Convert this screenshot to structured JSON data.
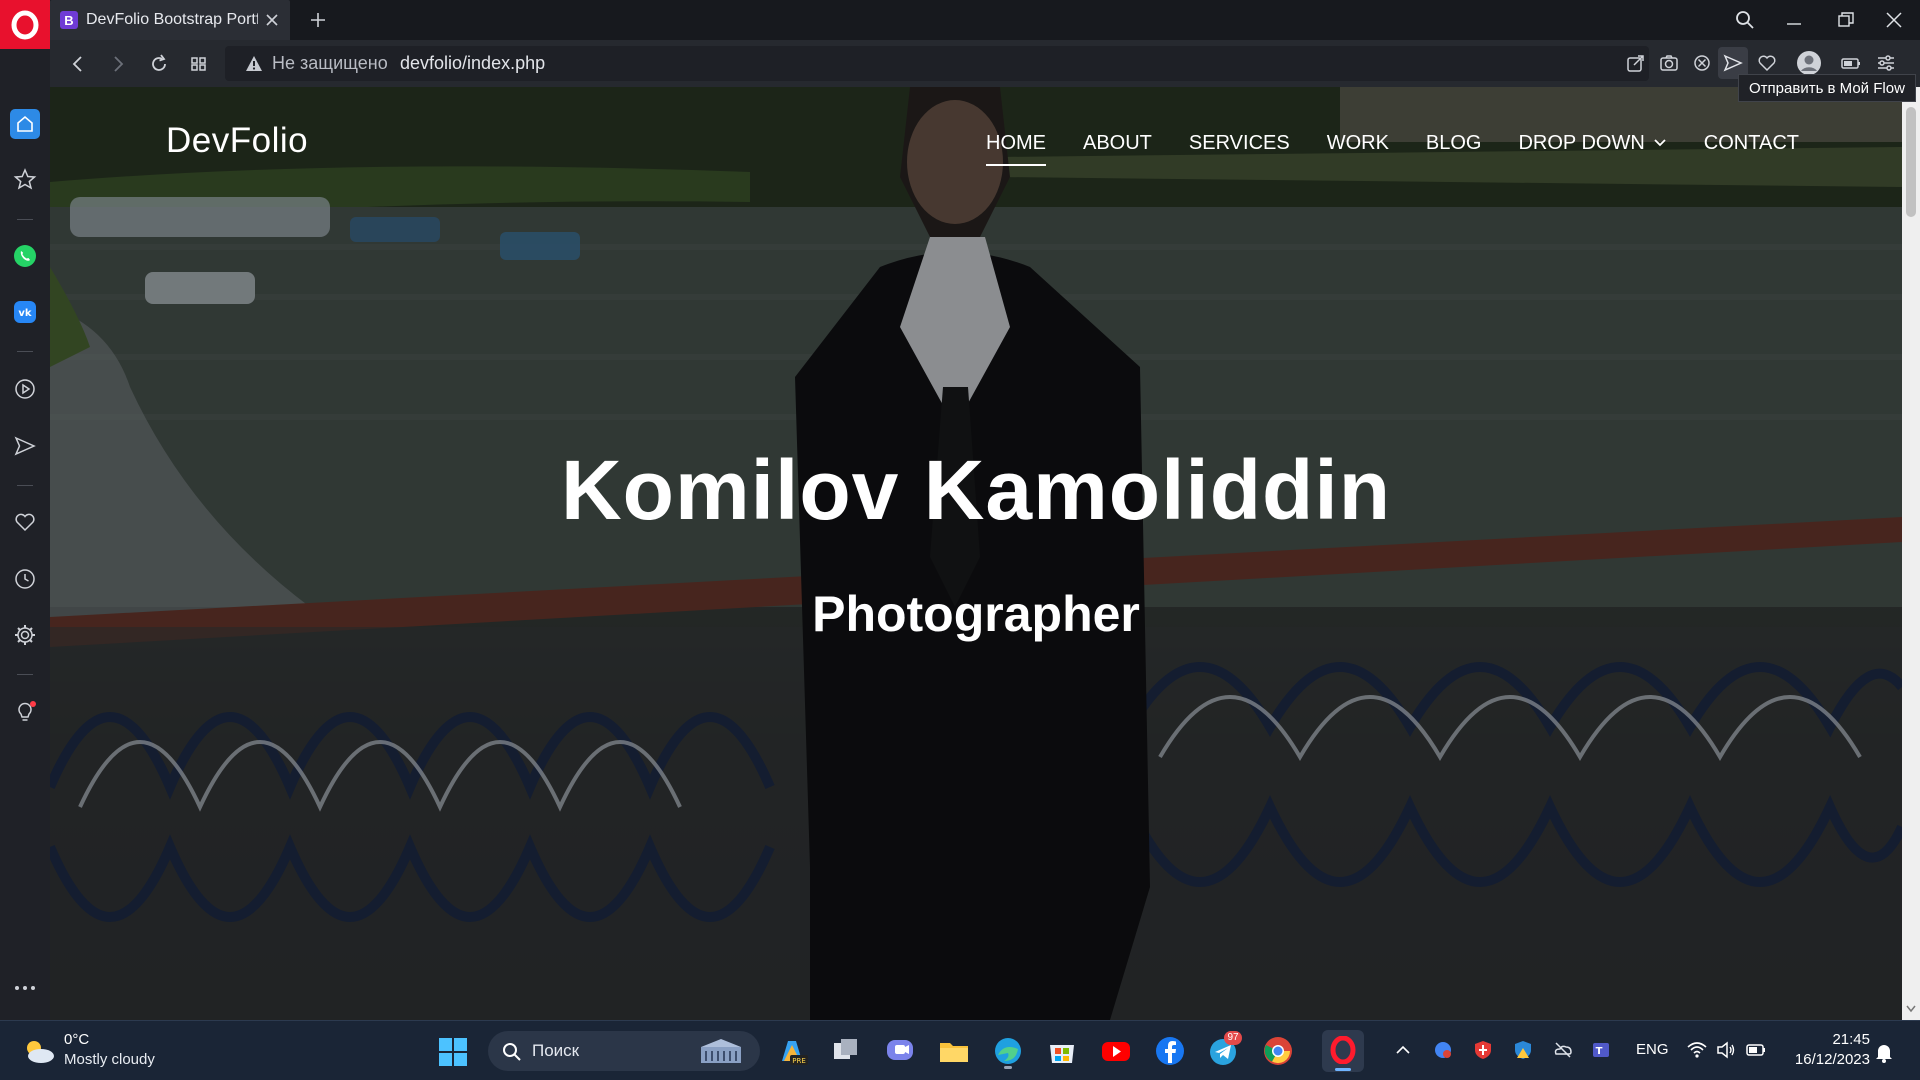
{
  "browser": {
    "tab_title": "DevFolio Bootstrap Portfoli",
    "tab_favicon_letter": "B",
    "security_label": "Не защищено",
    "url": "devfolio/index.php",
    "tooltip": "Отправить в Мой Flow"
  },
  "site": {
    "logo": "DevFolio",
    "nav": [
      {
        "label": "HOME",
        "active": true
      },
      {
        "label": "ABOUT",
        "active": false
      },
      {
        "label": "SERVICES",
        "active": false
      },
      {
        "label": "WORK",
        "active": false
      },
      {
        "label": "BLOG",
        "active": false
      },
      {
        "label": "DROP DOWN",
        "active": false,
        "dropdown": true
      },
      {
        "label": "CONTACT",
        "active": false
      }
    ],
    "hero_title": "Komilov Kamoliddin",
    "hero_subtitle": "Photographer"
  },
  "taskbar": {
    "weather_temp": "0°C",
    "weather_desc": "Mostly cloudy",
    "search_placeholder": "Поиск",
    "telegram_badge": "97",
    "language": "ENG",
    "time": "21:45",
    "date": "16/12/2023"
  },
  "colors": {
    "opera_red": "#e8112d",
    "sidebar_active": "#2d8ae6",
    "taskbar_bg": "#1a2536"
  }
}
